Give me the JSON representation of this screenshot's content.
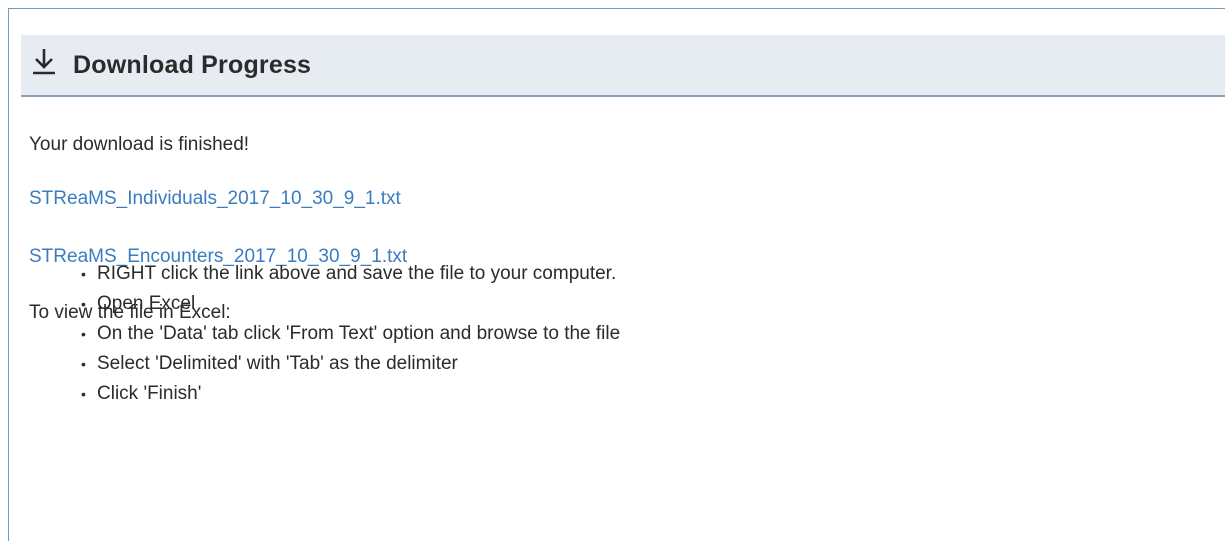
{
  "header": {
    "title": "Download Progress",
    "icon": "download-icon"
  },
  "status_message": "Your download is finished!",
  "files": [
    {
      "name": "STReaMS_Individuals_2017_10_30_9_1.txt"
    },
    {
      "name": "STReaMS_Encounters_2017_10_30_9_1.txt"
    }
  ],
  "instructions": {
    "intro": "To view the file in Excel:",
    "steps": [
      "RIGHT click the link above and save the file to your computer.",
      "Open Excel",
      "On the 'Data' tab click 'From Text' option and browse to the file",
      "Select 'Delimited' with 'Tab' as the delimiter",
      "Click 'Finish'"
    ]
  },
  "colors": {
    "header_bg": "#e7ecf3",
    "link": "#3a7cc1",
    "border": "#6f9bc4"
  }
}
